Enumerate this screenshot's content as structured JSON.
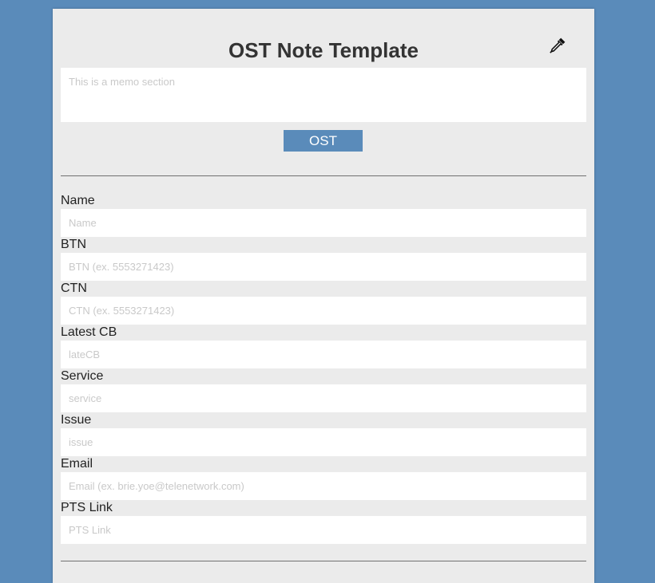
{
  "header": {
    "title": "OST Note Template",
    "picker_icon": "eyedropper-icon"
  },
  "memo": {
    "placeholder": "This is a memo section",
    "value": ""
  },
  "ost_button": {
    "label": "OST"
  },
  "colors": {
    "background": "#5a8bba",
    "card": "#ebebeb",
    "button": "#5a8bba",
    "input": "#ffffff",
    "placeholder": "#c9c9c9"
  },
  "fields": [
    {
      "label": "Name",
      "placeholder": "Name",
      "value": ""
    },
    {
      "label": "BTN",
      "placeholder": "BTN (ex. 5553271423)",
      "value": ""
    },
    {
      "label": "CTN",
      "placeholder": "CTN (ex. 5553271423)",
      "value": ""
    },
    {
      "label": "Latest CB",
      "placeholder": "lateCB",
      "value": ""
    },
    {
      "label": "Service",
      "placeholder": "service",
      "value": ""
    },
    {
      "label": "Issue",
      "placeholder": "issue",
      "value": ""
    },
    {
      "label": "Email",
      "placeholder": "Email (ex. brie.yoe@telenetwork.com)",
      "value": ""
    },
    {
      "label": "PTS Link",
      "placeholder": "PTS Link",
      "value": ""
    }
  ]
}
